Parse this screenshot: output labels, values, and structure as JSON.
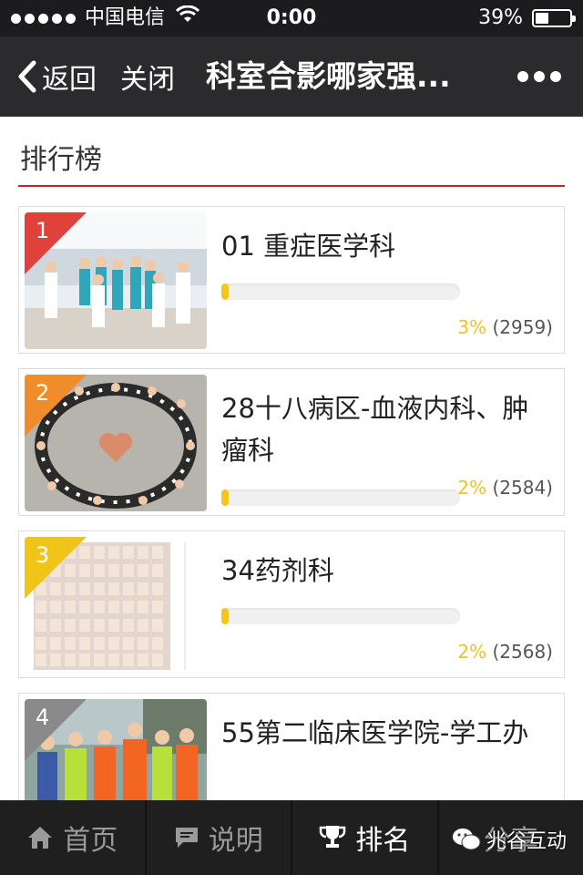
{
  "status_bar": {
    "carrier": "中国电信",
    "time": "0:00",
    "battery": "39%",
    "battery_level": 0.39
  },
  "nav": {
    "back_label": "返回",
    "close_label": "关闭",
    "title": "科室合影哪家强..."
  },
  "section": {
    "title": "排行榜"
  },
  "accent_color": "#b82a2a",
  "bar_color": "#f4c51d",
  "rank_colors": [
    "#e0413a",
    "#f08c2a",
    "#f0c419",
    "#8a8a8a"
  ],
  "rankings": [
    {
      "rank": "1",
      "name": "01 重症医学科",
      "percent": "3%",
      "count": "(2959)",
      "progress": 0.03
    },
    {
      "rank": "2",
      "name": "28十八病区-血液内科、肿瘤科",
      "percent": "2%",
      "count": "(2584)",
      "progress": 0.02
    },
    {
      "rank": "3",
      "name": "34药剂科",
      "percent": "2%",
      "count": "(2568)",
      "progress": 0.02
    },
    {
      "rank": "4",
      "name": "55第二临床医学院-学工办",
      "percent": "",
      "count": "",
      "progress": 0
    }
  ],
  "tabs": [
    {
      "label": "首页",
      "icon": "home-icon"
    },
    {
      "label": "说明",
      "icon": "comment-icon"
    },
    {
      "label": "排名",
      "icon": "trophy-icon",
      "active": true
    },
    {
      "label": "分享",
      "icon": "share-icon"
    }
  ],
  "watermark": "兆谷互动"
}
